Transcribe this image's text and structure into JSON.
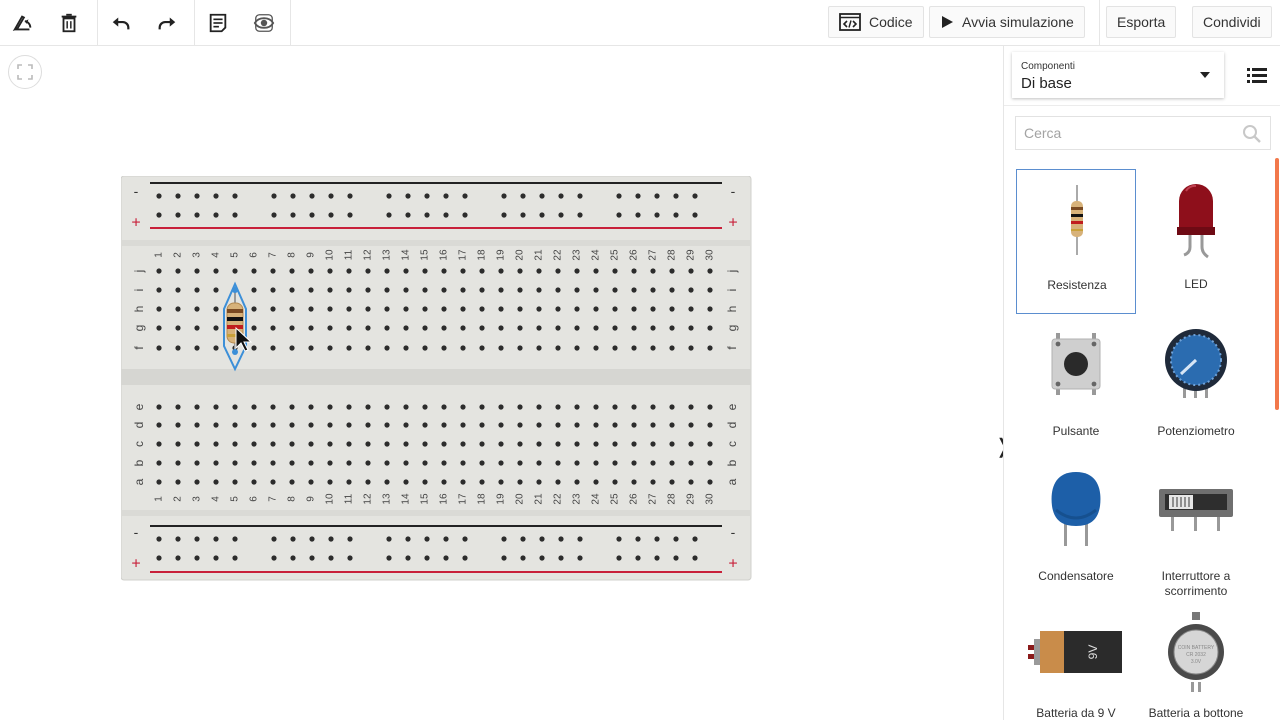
{
  "toolbar": {
    "tools": [
      {
        "name": "rotate-tool",
        "icon": "rotate-icon"
      },
      {
        "name": "delete-tool",
        "icon": "trash-icon"
      },
      {
        "name": "undo-tool",
        "icon": "undo-icon"
      },
      {
        "name": "redo-tool",
        "icon": "redo-icon"
      },
      {
        "name": "notes-tool",
        "icon": "notes-icon"
      },
      {
        "name": "visibility-tool",
        "icon": "eye-icon"
      }
    ],
    "code_label": "Codice",
    "simulate_label": "Avvia simulazione",
    "export_label": "Esporta",
    "share_label": "Condividi"
  },
  "panel": {
    "category_label": "Componenti",
    "category_value": "Di base",
    "search_placeholder": "Cerca",
    "components": [
      {
        "label": "Resistenza",
        "icon": "resistor-icon"
      },
      {
        "label": "LED",
        "icon": "led-icon"
      },
      {
        "label": "Pulsante",
        "icon": "pushbutton-icon"
      },
      {
        "label": "Potenziometro",
        "icon": "potentiometer-icon"
      },
      {
        "label": "Condensatore",
        "icon": "capacitor-icon"
      },
      {
        "label": "Interruttore a scorrimento",
        "icon": "slide-switch-icon"
      },
      {
        "label": "Batteria da 9 V",
        "icon": "battery-9v-icon"
      },
      {
        "label": "Batteria a bottone",
        "icon": "coin-battery-icon"
      }
    ]
  },
  "breadboard": {
    "columns": 30,
    "top_rows": [
      "j",
      "i",
      "h",
      "g",
      "f"
    ],
    "bottom_rows": [
      "e",
      "d",
      "c",
      "b",
      "a"
    ],
    "rail_minus": "-",
    "rail_plus": "+",
    "placed": {
      "component": "Resistenza",
      "column": 5,
      "from_row": "i",
      "to_row": "f"
    }
  },
  "colors": {
    "board": "#e4e4e0",
    "rail_red": "#c8203a",
    "rail_black": "#222222",
    "selection_blue": "#3c8fd8",
    "scrollbar": "#f2784b"
  }
}
